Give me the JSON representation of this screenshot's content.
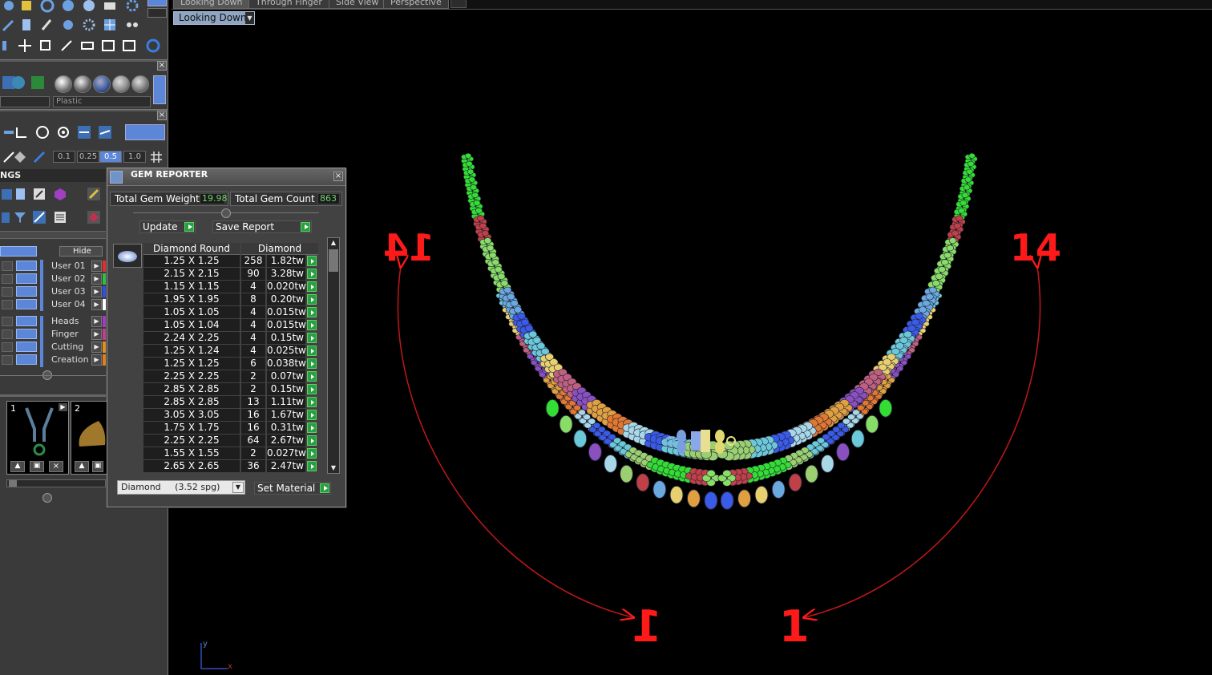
{
  "viewport_tabs": [
    "Looking Down",
    "Through Finger",
    "Side View",
    "Perspective"
  ],
  "view_dropdown": "Looking Down",
  "left_panel": {
    "material_dropdown": "Plastic",
    "snap_values": [
      "0.1",
      "0.25",
      "0.5",
      "1.0"
    ],
    "section_title": "NGS",
    "hide_label": "Hide",
    "layers": [
      {
        "name": "User 01",
        "color": "#e03030"
      },
      {
        "name": "User 02",
        "color": "#30c040"
      },
      {
        "name": "User 03",
        "color": "#3050e0"
      },
      {
        "name": "User 04",
        "color": "#ffffff"
      }
    ],
    "layers2": [
      {
        "name": "Heads",
        "color": "#a040c0"
      },
      {
        "name": "Finger",
        "color": "#c04090"
      },
      {
        "name": "Cutting",
        "color": "#e09020"
      },
      {
        "name": "Creation",
        "color": "#e08020"
      }
    ],
    "thumb_labels": [
      "1",
      "2"
    ]
  },
  "gem_reporter": {
    "title": "GEM REPORTER",
    "total_weight_label": "Total Gem Weight",
    "total_weight_value": "19.98",
    "total_count_label": "Total Gem Count",
    "total_count_value": "863",
    "update_label": "Update",
    "save_label": "Save Report",
    "col_shape": "Diamond Round",
    "col_material": "Diamond",
    "rows": [
      {
        "size": "1.25 X 1.25",
        "count": "258",
        "weight": "1.82tw"
      },
      {
        "size": "2.15 X 2.15",
        "count": "90",
        "weight": "3.28tw"
      },
      {
        "size": "1.15 X 1.15",
        "count": "4",
        "weight": "0.020tw"
      },
      {
        "size": "1.95 X 1.95",
        "count": "8",
        "weight": "0.20tw"
      },
      {
        "size": "1.05 X 1.05",
        "count": "4",
        "weight": "0.015tw"
      },
      {
        "size": "1.05 X 1.04",
        "count": "4",
        "weight": "0.015tw"
      },
      {
        "size": "2.24 X 2.25",
        "count": "4",
        "weight": "0.15tw"
      },
      {
        "size": "1.25 X 1.24",
        "count": "4",
        "weight": "0.025tw"
      },
      {
        "size": "1.25 X 1.25",
        "count": "6",
        "weight": "0.038tw"
      },
      {
        "size": "2.25 X 2.25",
        "count": "2",
        "weight": "0.07tw"
      },
      {
        "size": "2.85 X 2.85",
        "count": "2",
        "weight": "0.15tw"
      },
      {
        "size": "2.85 X 2.85",
        "count": "13",
        "weight": "1.11tw"
      },
      {
        "size": "3.05 X 3.05",
        "count": "16",
        "weight": "1.67tw"
      },
      {
        "size": "1.75 X 1.75",
        "count": "16",
        "weight": "0.31tw"
      },
      {
        "size": "2.25 X 2.25",
        "count": "64",
        "weight": "2.67tw"
      },
      {
        "size": "1.55 X 1.55",
        "count": "2",
        "weight": "0.027tw"
      },
      {
        "size": "2.65 X 2.65",
        "count": "36",
        "weight": "2.47tw"
      }
    ],
    "material_select": "Diamond     (3.52 spg)",
    "set_material_label": "Set Material"
  },
  "annotations": {
    "left_top": "14",
    "right_top": "14",
    "left_bottom": "1",
    "right_bottom": "1"
  },
  "axis": {
    "y": "y",
    "x": "x"
  },
  "colors": {
    "annotation_red": "#ff1a1a",
    "accent_blue": "#5c86d8",
    "confirm_green": "#27a042"
  }
}
